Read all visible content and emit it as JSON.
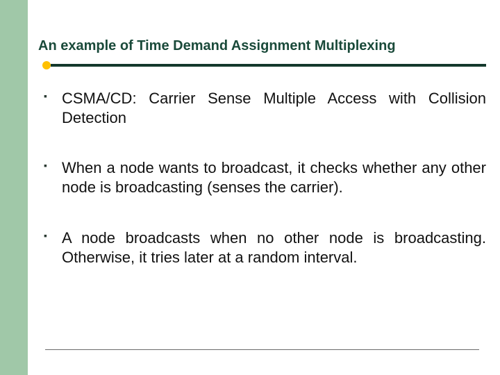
{
  "slide": {
    "title": "An example of Time Demand Assignment Multiplexing",
    "bullets": [
      "CSMA/CD: Carrier Sense Multiple Access with Collision Detection",
      "When a node wants to broadcast, it checks whether any other node is broadcasting (senses the carrier).",
      "A node broadcasts when no other node is broadcasting. Otherwise, it tries later at a random interval."
    ]
  },
  "colors": {
    "left_bar": "#a0c8a8",
    "title_text": "#1a4a3a",
    "rule": "#14382c",
    "dot": "#ffc000"
  }
}
